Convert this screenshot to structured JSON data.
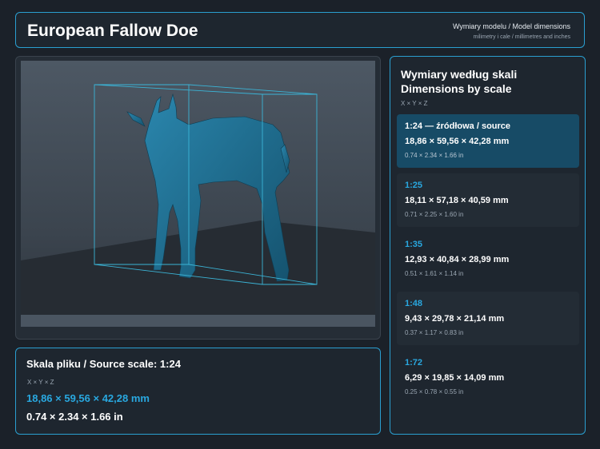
{
  "header": {
    "title": "European Fallow Doe",
    "subtitle": "Wymiary modelu / Model dimensions",
    "note": "milimetry i cale / millimetres and inches"
  },
  "viewer": {
    "icon": "deer-model-preview",
    "colors": {
      "model": "#1f6f93",
      "bbox": "#3bb4d6",
      "background": "#4a5561",
      "floor": "#2a3038"
    }
  },
  "source": {
    "title": "Skala pliku / Source scale: 1:24",
    "axis": "X × Y × Z",
    "mm": "18,86 × 59,56 × 42,28 mm",
    "inches": "0.74 × 2.34 × 1.66 in"
  },
  "scales": {
    "title": "Wymiary według skali Dimensions by scale",
    "axis": "X × Y × Z",
    "rows": [
      {
        "label": "1:24  —  źródłowa / source",
        "mm": "18,86 × 59,56 × 42,28 mm",
        "inches": "0.74 × 2.34 × 1.66 in"
      },
      {
        "label": "1:25",
        "mm": "18,11 × 57,18 × 40,59 mm",
        "inches": "0.71 × 2.25 × 1.60 in"
      },
      {
        "label": "1:35",
        "mm": "12,93 × 40,84 × 28,99 mm",
        "inches": "0.51 × 1.61 × 1.14 in"
      },
      {
        "label": "1:48",
        "mm": "9,43 × 29,78 × 21,14 mm",
        "inches": "0.37 × 1.17 × 0.83 in"
      },
      {
        "label": "1:72",
        "mm": "6,29 × 19,85 × 14,09 mm",
        "inches": "0.25 × 0.78 × 0.55 in"
      }
    ],
    "accent": "#29a8e0"
  }
}
